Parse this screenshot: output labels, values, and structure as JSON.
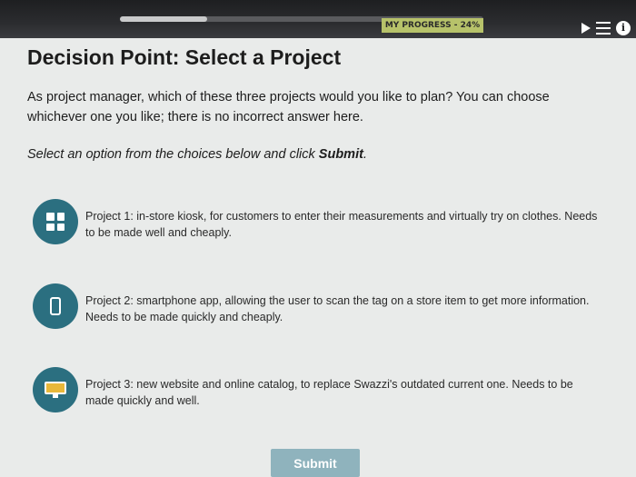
{
  "progress": {
    "label": "MY PROGRESS - 24%",
    "value": 0.24
  },
  "page": {
    "title": "Decision Point: Select a Project",
    "intro": "As project manager, which of these three projects would you like to plan? You can choose whichever one you like; there is no incorrect answer here.",
    "instruction_pre": "Select an option from the choices below and click ",
    "instruction_bold": "Submit",
    "instruction_post": "."
  },
  "options": [
    {
      "icon": "kiosk-grid-icon",
      "text": "Project 1: in-store kiosk, for customers to enter their measurements and virtually try on clothes. Needs to be made well and cheaply."
    },
    {
      "icon": "smartphone-icon",
      "text": "Project 2: smartphone app, allowing the user to scan the tag on a store item to get more information. Needs to be made quickly and cheaply."
    },
    {
      "icon": "monitor-icon",
      "text": "Project 3: new website and online catalog, to replace Swazzi's outdated current one. Needs to be made quickly and well."
    }
  ],
  "submit_label": "Submit",
  "colors": {
    "accent": "#2b6f80",
    "submit": "#8fb3bd",
    "progress": "#b7c26a"
  }
}
